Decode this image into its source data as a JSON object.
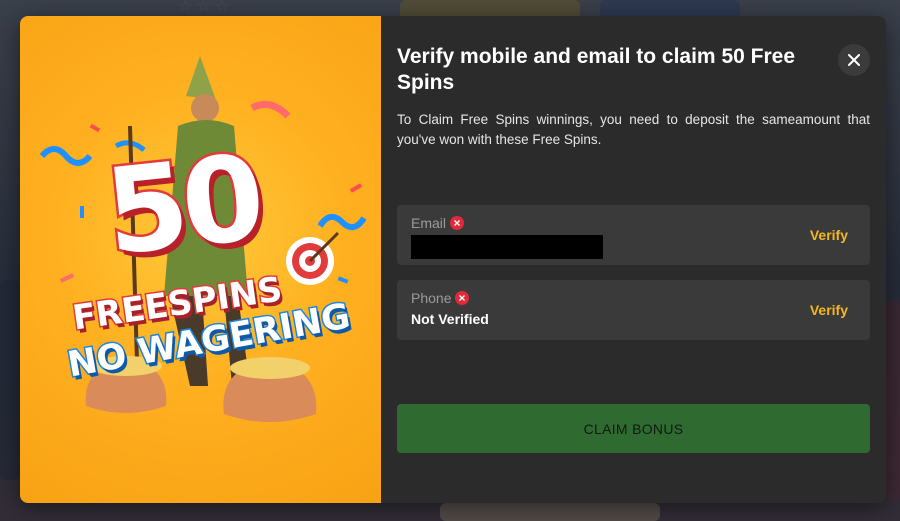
{
  "background": {
    "stars": "☆☆☆"
  },
  "promo": {
    "number": "50",
    "line1": "FREESPINS",
    "line2": "NO WAGERING"
  },
  "modal": {
    "title": "Verify mobile and email to claim 50 Free Spins",
    "description": "To Claim Free Spins winnings, you need to deposit the sameamount that you've won with these Free Spins.",
    "close_icon": "close-icon",
    "email": {
      "label": "Email",
      "status_icon": "error-icon",
      "value_redacted": true,
      "action": "Verify"
    },
    "phone": {
      "label": "Phone",
      "status_icon": "error-icon",
      "value": "Not Verified",
      "action": "Verify"
    },
    "claim_button": "CLAIM BONUS"
  },
  "colors": {
    "accent": "#f5b623",
    "claim_button": "#2f6a31",
    "error": "#e02a3a",
    "promo_bg": "#ffb020"
  }
}
